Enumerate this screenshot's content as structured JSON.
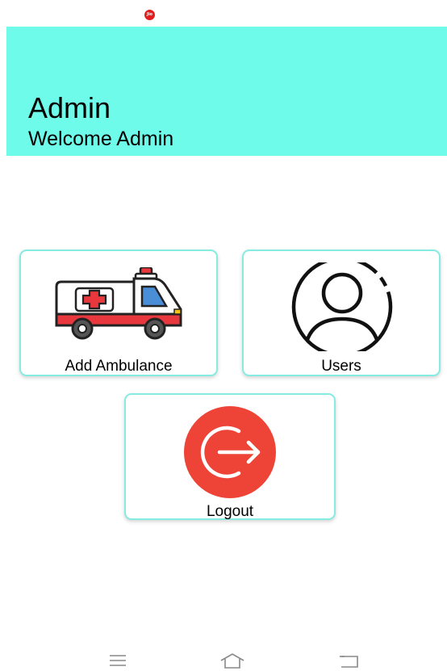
{
  "status_bar": {
    "carrier_logo": "Jio"
  },
  "header": {
    "title": "Admin",
    "subtitle": "Welcome Admin",
    "background_color": "#6ffbea"
  },
  "cards": {
    "add_ambulance": {
      "label": "Add Ambulance",
      "icon": "ambulance-icon"
    },
    "users": {
      "label": "Users",
      "icon": "user-icon"
    },
    "logout": {
      "label": "Logout",
      "icon": "logout-icon"
    }
  },
  "colors": {
    "card_border": "#86ece2",
    "logout_red": "#ee4437",
    "ambulance_red": "#e8383d"
  },
  "navigation": {
    "menu_icon": "menu-icon",
    "home_icon": "home-icon",
    "back_icon": "back-icon"
  }
}
